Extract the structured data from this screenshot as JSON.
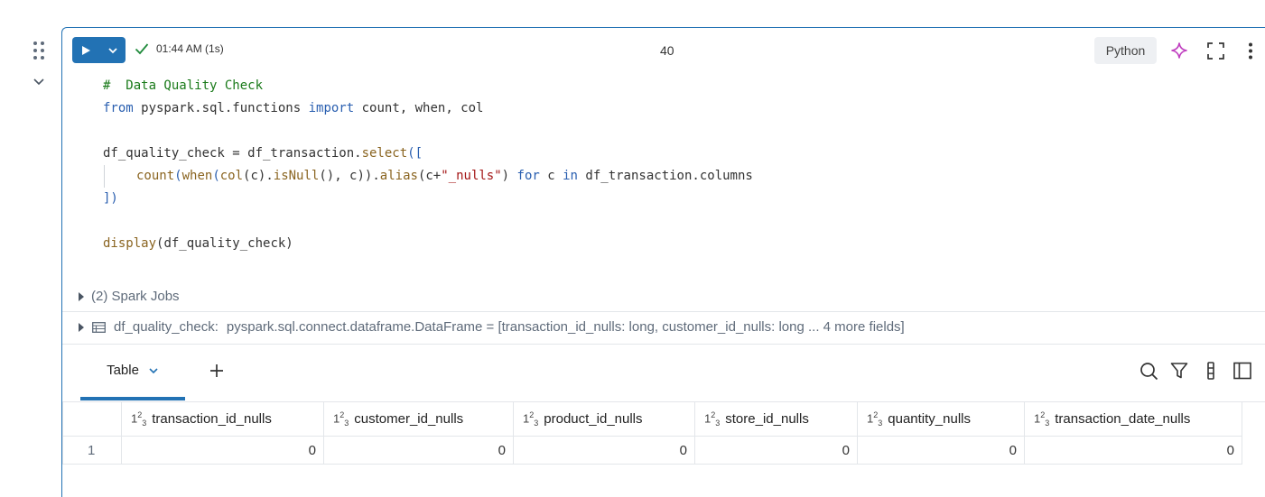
{
  "cell": {
    "run_status_time": "01:44 AM (1s)",
    "cell_number": "40",
    "language": "Python"
  },
  "code_lines": [
    [
      {
        "t": "#  Data Quality Check",
        "c": "cm"
      }
    ],
    [
      {
        "t": "from",
        "c": "kw"
      },
      {
        "t": " pyspark.sql.functions ",
        "c": ""
      },
      {
        "t": "import",
        "c": "kw"
      },
      {
        "t": " count, when, col",
        "c": ""
      }
    ],
    [],
    [
      {
        "t": "df_quality_check = df_transaction.",
        "c": ""
      },
      {
        "t": "select",
        "c": "fn"
      },
      {
        "t": "([",
        "c": "br"
      }
    ],
    [
      {
        "t": "",
        "c": "indent"
      },
      {
        "t": "count",
        "c": "fn"
      },
      {
        "t": "(",
        "c": "br"
      },
      {
        "t": "when",
        "c": "fn"
      },
      {
        "t": "(",
        "c": "br"
      },
      {
        "t": "col",
        "c": "fn"
      },
      {
        "t": "(c).",
        "c": ""
      },
      {
        "t": "isNull",
        "c": "fn"
      },
      {
        "t": "(), c)).",
        "c": ""
      },
      {
        "t": "alias",
        "c": "fn"
      },
      {
        "t": "(c+",
        "c": ""
      },
      {
        "t": "\"_nulls\"",
        "c": "str"
      },
      {
        "t": ") ",
        "c": ""
      },
      {
        "t": "for",
        "c": "kw"
      },
      {
        "t": " c ",
        "c": ""
      },
      {
        "t": "in",
        "c": "kw"
      },
      {
        "t": " df_transaction.columns",
        "c": ""
      }
    ],
    [
      {
        "t": "])",
        "c": "br"
      }
    ],
    [],
    [
      {
        "t": "display",
        "c": "fn"
      },
      {
        "t": "(df_quality_check)",
        "c": ""
      }
    ]
  ],
  "spark_jobs_label": "(2) Spark Jobs",
  "schema": {
    "name": "df_quality_check:",
    "type_text": "pyspark.sql.connect.dataframe.DataFrame = [transaction_id_nulls: long, customer_id_nulls: long ... 4 more fields]"
  },
  "tabs": {
    "table_label": "Table"
  },
  "table": {
    "type_icon_text": "123",
    "columns": [
      "transaction_id_nulls",
      "customer_id_nulls",
      "product_id_nulls",
      "store_id_nulls",
      "quantity_nulls",
      "transaction_date_nulls"
    ],
    "rows": [
      {
        "index": "1",
        "values": [
          "0",
          "0",
          "0",
          "0",
          "0",
          "0"
        ]
      }
    ]
  },
  "colors": {
    "accent": "#2272b4",
    "success": "#1f8a3b",
    "ai": "#c040c0"
  },
  "icons": [
    "drag-handle-icon",
    "chevron-down-icon",
    "play-icon",
    "check-icon",
    "sparkle-icon",
    "expand-icon",
    "kebab-menu-icon",
    "caret-right-icon",
    "dataframe-icon",
    "plus-icon",
    "search-icon",
    "filter-icon",
    "column-visibility-icon",
    "sidebar-panel-icon"
  ]
}
